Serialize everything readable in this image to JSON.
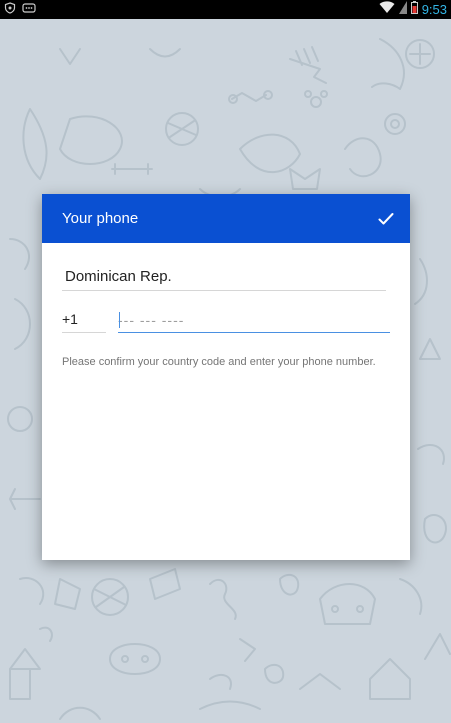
{
  "status_bar": {
    "time": "9:53",
    "icons": [
      "shield-icon",
      "bbm-icon",
      "wifi-icon",
      "battery-icon"
    ],
    "clock_color": "#33b5e5"
  },
  "background": {
    "color": "#d4dde4",
    "pattern": "doodle-pattern"
  },
  "dialog": {
    "title": "Your phone",
    "header_color": "#0a50d2",
    "confirm_icon": "check-icon",
    "country": "Dominican Rep.",
    "country_code": "+1",
    "phone_placeholder": "--- --- ----",
    "phone_value": "",
    "hint": "Please confirm your country code and enter your phone number."
  }
}
